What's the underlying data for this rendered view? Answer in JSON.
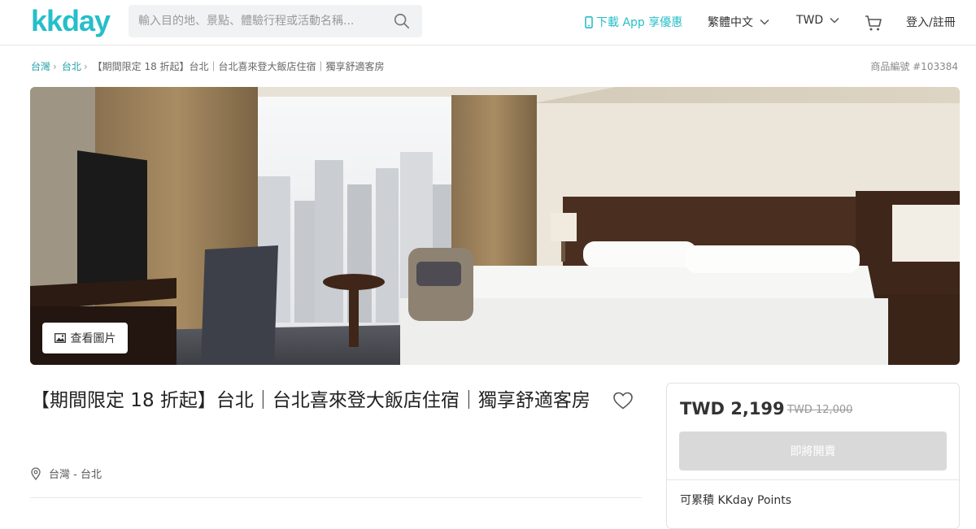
{
  "header": {
    "logo": "kkday",
    "search_placeholder": "輸入目的地、景點、體驗行程或活動名稱...",
    "app_link": "下載 App 享優惠",
    "language": "繁體中文",
    "currency": "TWD",
    "login": "登入/註冊"
  },
  "breadcrumb": {
    "items": [
      "台灣",
      "台北",
      "【期間限定 18 折起】台北｜台北喜來登大飯店住宿｜獨享舒適客房"
    ]
  },
  "product_id": "商品編號 #103384",
  "hero": {
    "view_photos": "查看圖片"
  },
  "product": {
    "title": "【期間限定 18 折起】台北｜台北喜來登大飯店住宿｜獨享舒適客房",
    "location": "台灣 - 台北"
  },
  "pricing": {
    "price": "TWD 2,199",
    "original_price": "TWD 12,000",
    "button": "即將開賣",
    "points": "可累積 KKday Points"
  },
  "colors": {
    "brand": "#26bec9",
    "disabled_button": "#d9d9d9"
  }
}
